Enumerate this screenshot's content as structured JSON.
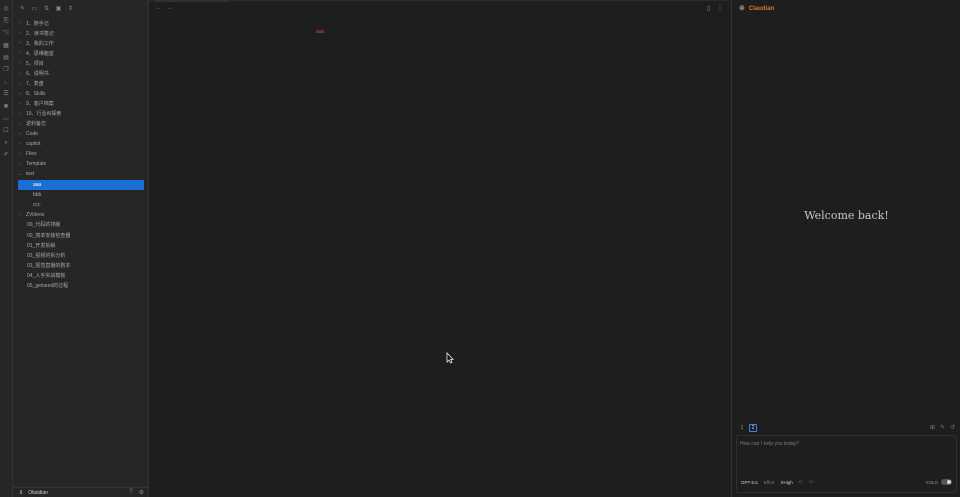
{
  "ribbon": {
    "icons": [
      "compass-icon",
      "file-search-icon",
      "graph-icon",
      "grid-icon",
      "calendar-icon",
      "copy-icon",
      "terminal-icon",
      "list-icon",
      "tools-icon",
      "code-icon",
      "bot-icon",
      "search-icon",
      "wand-icon"
    ]
  },
  "sidebar": {
    "toolbar": [
      "new-note-icon",
      "new-folder-icon",
      "sort-icon",
      "collapse-icon",
      "expand-icon"
    ],
    "tree": [
      {
        "name": "1、随手记",
        "type": "folder"
      },
      {
        "name": "2、读书笔记",
        "type": "folder"
      },
      {
        "name": "3、我的工作",
        "type": "folder"
      },
      {
        "name": "4、思维脑室",
        "type": "folder"
      },
      {
        "name": "5、项目",
        "type": "folder"
      },
      {
        "name": "6、说明书",
        "type": "folder"
      },
      {
        "name": "7、复盘",
        "type": "folder"
      },
      {
        "name": "8、Skills",
        "type": "folder"
      },
      {
        "name": "9、客户档案",
        "type": "folder"
      },
      {
        "name": "10、行业AI探索",
        "type": "folder"
      },
      {
        "name": "返利备忘",
        "type": "folder"
      },
      {
        "name": "Code",
        "type": "folder"
      },
      {
        "name": "copilot",
        "type": "folder"
      },
      {
        "name": "Files",
        "type": "folder"
      },
      {
        "name": "Template",
        "type": "folder"
      },
      {
        "name": "test",
        "type": "folder-open"
      },
      {
        "name": "aaa",
        "type": "child",
        "active": true
      },
      {
        "name": "bbb",
        "type": "child"
      },
      {
        "name": "ccc",
        "type": "child"
      },
      {
        "name": "ZVideos",
        "type": "folder"
      },
      {
        "name": "00_代码的排版",
        "type": "file"
      },
      {
        "name": "00_简单安装检查器",
        "type": "file"
      },
      {
        "name": "01_开发拆解",
        "type": "file"
      },
      {
        "name": "02_视频的拆分析",
        "type": "file"
      },
      {
        "name": "03_视觉直播的剧本",
        "type": "file"
      },
      {
        "name": "04_入手实战模板",
        "type": "file"
      },
      {
        "name": "05_getseed的过程",
        "type": "file"
      }
    ],
    "footer": {
      "vault": "Obsidian"
    }
  },
  "editor": {
    "back": "←",
    "forward": "→",
    "content": "aaa"
  },
  "chat": {
    "title": "Claudian",
    "welcome": "Welcome back!",
    "tabs": [
      "1",
      "2"
    ],
    "placeholder": "How can I help you today?",
    "model": "GPT-5.5",
    "effort_label": "Effort",
    "effort_value": "XHigh",
    "yolo_label": "YOLO"
  }
}
